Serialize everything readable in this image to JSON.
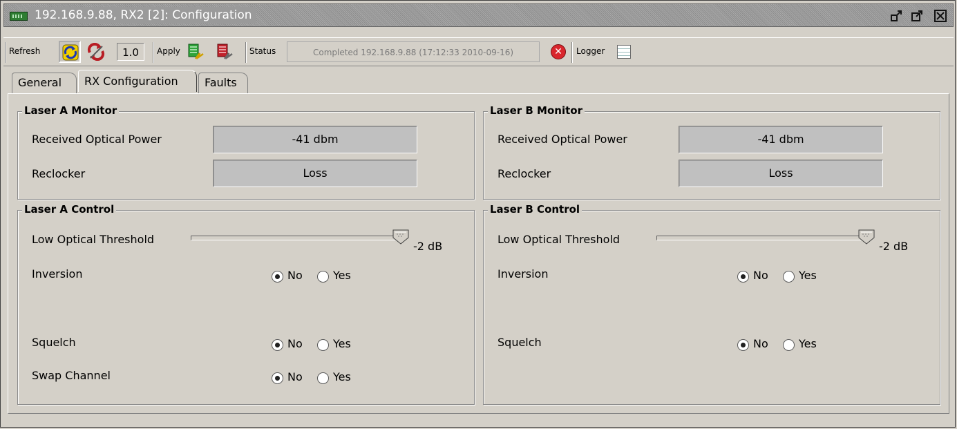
{
  "window": {
    "title": "192.168.9.88, RX2  [2]: Configuration",
    "controls": [
      "restore-icon",
      "maximize-icon",
      "close-icon"
    ]
  },
  "toolbar": {
    "refresh_label": "Refresh",
    "refresh_interval": "1.0",
    "apply_label": "Apply",
    "status_label": "Status",
    "status_text": "Completed 192.168.9.88 (17:12:33  2010-09-16)",
    "logger_label": "Logger"
  },
  "tabs": [
    {
      "label": "General",
      "active": false
    },
    {
      "label": "RX Configuration",
      "active": true
    },
    {
      "label": "Faults",
      "active": false
    }
  ],
  "laser_a_monitor": {
    "title": "Laser A Monitor",
    "received_power_label": "Received Optical Power",
    "received_power_value": "-41 dbm",
    "reclocker_label": "Reclocker",
    "reclocker_value": "Loss"
  },
  "laser_b_monitor": {
    "title": "Laser B Monitor",
    "received_power_label": "Received Optical Power",
    "received_power_value": "-41 dbm",
    "reclocker_label": "Reclocker",
    "reclocker_value": "Loss"
  },
  "laser_a_control": {
    "title": "Laser A Control",
    "threshold_label": "Low Optical Threshold",
    "threshold_value": "-2 dB",
    "threshold_fraction": 1.0,
    "inversion_label": "Inversion",
    "squelch_label": "Squelch",
    "swap_label": "Swap Channel",
    "no_label": "No",
    "yes_label": "Yes",
    "inversion": "No",
    "squelch": "No",
    "swap_channel": "No"
  },
  "laser_b_control": {
    "title": "Laser B Control",
    "threshold_label": "Low Optical Threshold",
    "threshold_value": "-2 dB",
    "threshold_fraction": 1.0,
    "inversion_label": "Inversion",
    "squelch_label": "Squelch",
    "no_label": "No",
    "yes_label": "Yes",
    "inversion": "No",
    "squelch": "No"
  }
}
